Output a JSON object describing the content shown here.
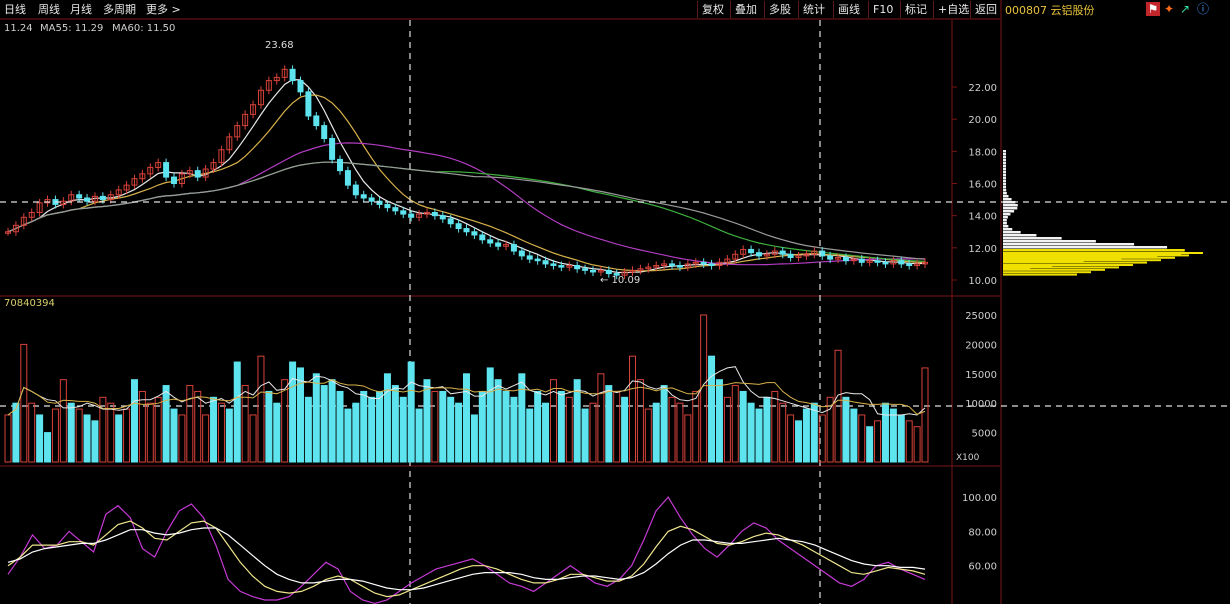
{
  "toolbar": {
    "periods": [
      "日线",
      "周线",
      "月线",
      "多周期",
      "更多 >"
    ],
    "buttons": [
      "复权",
      "叠加",
      "多股",
      "统计",
      "画线",
      "F10",
      "标记",
      "+自选",
      "返回"
    ]
  },
  "stock": {
    "code_name": "000807 云铝股份"
  },
  "ma_legend": [
    {
      "label": "11.24",
      "color": "#ffffff"
    },
    {
      "label": "MA55: 11.29",
      "color": "#3fd23f"
    },
    {
      "label": "MA60: 11.50",
      "color": "#d0d0d0"
    }
  ],
  "volume_label": "70840394",
  "volume_unit": "X100",
  "price_axis": [
    "22.00",
    "20.00",
    "18.00",
    "16.00",
    "14.00",
    "12.00",
    "10.00"
  ],
  "volume_axis": [
    "25000",
    "20000",
    "15000",
    "10000",
    "5000"
  ],
  "kdj_axis": [
    "100.00",
    "80.00",
    "60.00"
  ],
  "annotations": {
    "high": "23.68",
    "low": "10.09"
  },
  "colors": {
    "up": "#d8423a",
    "down": "#5ee4ef",
    "grid": "#7a1616",
    "yellow": "#f0e000"
  },
  "chart_data": [
    {
      "type": "candlestick",
      "title": "",
      "y_range": [
        10,
        23.68
      ],
      "y_ticks": [
        22,
        20,
        18,
        16,
        14,
        12,
        10
      ],
      "high_label": 23.68,
      "low_label": 10.09,
      "ohlc_close": [
        13.0,
        13.4,
        13.9,
        14.2,
        14.8,
        15.0,
        14.7,
        14.9,
        15.3,
        15.1,
        14.9,
        15.2,
        15.0,
        15.3,
        15.6,
        15.9,
        16.3,
        16.6,
        17.0,
        17.3,
        16.4,
        16.0,
        16.6,
        16.8,
        16.4,
        16.9,
        17.3,
        18.1,
        18.9,
        19.6,
        20.3,
        20.9,
        21.8,
        22.4,
        22.6,
        23.1,
        22.4,
        21.7,
        20.2,
        19.6,
        18.8,
        17.5,
        16.8,
        15.9,
        15.3,
        15.1,
        14.9,
        14.7,
        14.5,
        14.3,
        14.1,
        13.9,
        14.1,
        14.2,
        14.0,
        13.8,
        13.5,
        13.2,
        13.0,
        12.8,
        12.5,
        12.3,
        12.1,
        12.2,
        11.8,
        11.5,
        11.3,
        11.2,
        11.0,
        10.9,
        10.8,
        10.9,
        10.7,
        10.6,
        10.5,
        10.6,
        10.4,
        10.3,
        10.5,
        10.6,
        10.7,
        10.8,
        10.9,
        11.0,
        10.9,
        10.8,
        11.0,
        11.1,
        11.0,
        10.9,
        11.1,
        11.3,
        11.6,
        11.9,
        11.7,
        11.5,
        11.6,
        11.8,
        11.6,
        11.4,
        11.5,
        11.6,
        11.8,
        11.5,
        11.3,
        11.4,
        11.2,
        11.3,
        11.1,
        11.2,
        11.1,
        11.0,
        11.2,
        11.0,
        10.9,
        11.0,
        11.1
      ]
    },
    {
      "type": "bar",
      "title": "",
      "y_range": [
        0,
        25000
      ],
      "values": [
        8000,
        10000,
        20000,
        10000,
        8000,
        5000,
        9000,
        14000,
        10000,
        9000,
        8000,
        7000,
        11000,
        10000,
        8000,
        9000,
        14000,
        12000,
        10000,
        11000,
        13000,
        9000,
        8000,
        13000,
        12000,
        8000,
        11000,
        10000,
        9000,
        17000,
        13000,
        8000,
        18000,
        12000,
        10000,
        14000,
        17000,
        16000,
        11000,
        15000,
        13000,
        14000,
        12000,
        9000,
        10000,
        12000,
        11000,
        12000,
        15000,
        13000,
        11000,
        17000,
        9000,
        14000,
        12000,
        12000,
        11000,
        10000,
        15000,
        8000,
        12000,
        16000,
        14000,
        12000,
        11000,
        15000,
        9000,
        12000,
        10000,
        14000,
        12000,
        11000,
        14000,
        9000,
        10000,
        15000,
        13000,
        12000,
        11000,
        18000,
        14000,
        9000,
        10000,
        13000,
        11000,
        10000,
        8000,
        12000,
        25000,
        18000,
        14000,
        11000,
        13000,
        12000,
        10000,
        9000,
        11000,
        12000,
        10000,
        8000,
        7000,
        9000,
        10000,
        8000,
        11000,
        19000,
        11000,
        9000,
        8000,
        6000,
        7000,
        10000,
        9000,
        8000,
        7000,
        6000,
        16000
      ],
      "down_flags": [
        0,
        1,
        0,
        0,
        1,
        1,
        0,
        0,
        1,
        0,
        1,
        1,
        0,
        0,
        1,
        0,
        1,
        0,
        0,
        0,
        1,
        1,
        0,
        0,
        0,
        0,
        1,
        0,
        1,
        1,
        0,
        0,
        0,
        1,
        1,
        0,
        1,
        1,
        1,
        1,
        1,
        1,
        1,
        1,
        1,
        1,
        1,
        1,
        1,
        1,
        1,
        1,
        1,
        1,
        0,
        1,
        1,
        1,
        1,
        1,
        1,
        1,
        1,
        1,
        1,
        1,
        1,
        1,
        1,
        0,
        1,
        0,
        1,
        1,
        0,
        0,
        1,
        0,
        1,
        0,
        0,
        0,
        1,
        1,
        0,
        0,
        0,
        0,
        0,
        1,
        1,
        0,
        0,
        1,
        1,
        1,
        1,
        0,
        0,
        0,
        1,
        1,
        1,
        0,
        0,
        0,
        1,
        1,
        0,
        1,
        0,
        1,
        1,
        1,
        0,
        0,
        0
      ]
    },
    {
      "type": "line",
      "title": "",
      "y_range": [
        40,
        110
      ],
      "y_ticks": [
        100,
        80,
        60
      ],
      "series": [
        {
          "color": "#c63ad6",
          "values": [
            55,
            65,
            78,
            70,
            72,
            80,
            74,
            68,
            90,
            95,
            88,
            70,
            65,
            80,
            92,
            96,
            88,
            72,
            52,
            45,
            42,
            40,
            40,
            42,
            48,
            55,
            62,
            58,
            45,
            40,
            38,
            40,
            45,
            50,
            54,
            58,
            60,
            62,
            64,
            60,
            55,
            50,
            48,
            45,
            50,
            55,
            60,
            55,
            50,
            48,
            52,
            60,
            75,
            92,
            100,
            88,
            78,
            70,
            65,
            72,
            80,
            85,
            82,
            75,
            70,
            65,
            60,
            55,
            50,
            48,
            52,
            60,
            62,
            58,
            55,
            52
          ]
        },
        {
          "color": "#f0e68c",
          "values": [
            60,
            65,
            72,
            72,
            72,
            74,
            74,
            72,
            78,
            84,
            86,
            82,
            76,
            75,
            80,
            85,
            86,
            82,
            72,
            62,
            54,
            48,
            45,
            44,
            45,
            48,
            52,
            54,
            52,
            48,
            44,
            42,
            43,
            46,
            49,
            52,
            55,
            58,
            60,
            60,
            58,
            55,
            52,
            50,
            50,
            52,
            55,
            55,
            53,
            51,
            51,
            54,
            61,
            71,
            80,
            83,
            81,
            77,
            73,
            72,
            74,
            77,
            79,
            78,
            75,
            72,
            68,
            64,
            60,
            56,
            55,
            57,
            59,
            58,
            57,
            55
          ]
        },
        {
          "color": "#ffffff",
          "values": [
            62,
            64,
            68,
            70,
            71,
            72,
            73,
            73,
            75,
            78,
            81,
            81,
            79,
            78,
            79,
            81,
            82,
            82,
            78,
            72,
            66,
            60,
            55,
            52,
            50,
            50,
            51,
            52,
            52,
            51,
            49,
            47,
            46,
            46,
            47,
            49,
            51,
            53,
            55,
            56,
            56,
            56,
            55,
            53,
            52,
            52,
            53,
            54,
            54,
            53,
            52,
            53,
            56,
            61,
            67,
            72,
            75,
            75,
            74,
            73,
            73,
            74,
            75,
            76,
            75,
            74,
            72,
            69,
            66,
            63,
            61,
            60,
            60,
            59,
            59,
            58
          ]
        }
      ]
    }
  ]
}
